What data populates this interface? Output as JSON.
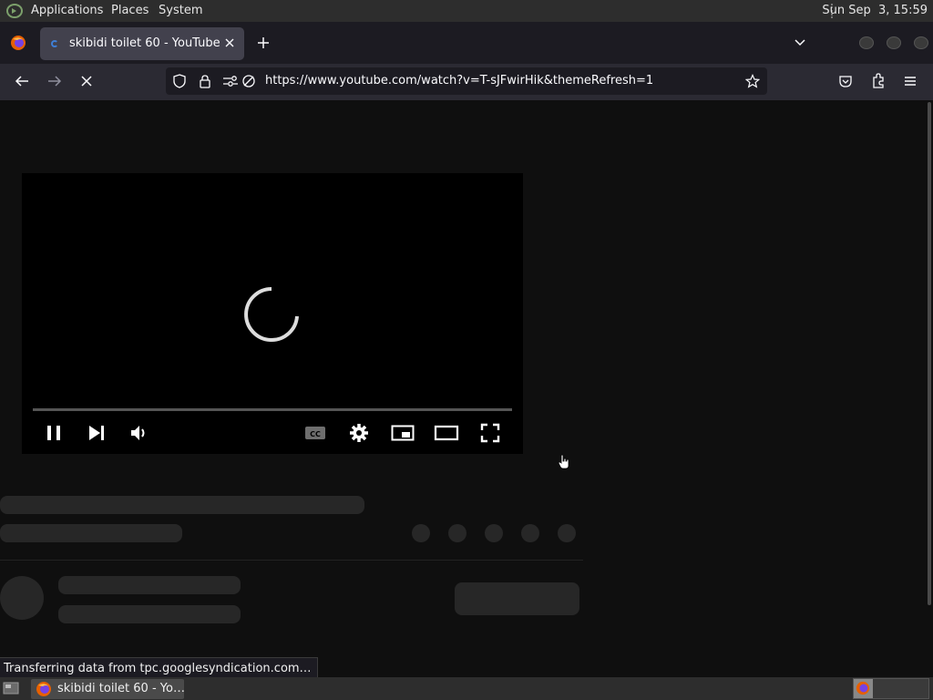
{
  "top_panel": {
    "menus": [
      "Applications",
      "Places",
      "System"
    ],
    "clock": "Sun Sep  3, 15:59"
  },
  "browser": {
    "tab_title": "skibidi toilet 60 - YouTube",
    "url": "https://www.youtube.com/watch?v=T-sJFwirHik&themeRefresh=1"
  },
  "status_tip": "Transferring data from tpc.googlesyndication.com…",
  "taskbar": {
    "item_label": "skibidi toilet 60 - Yo…"
  },
  "icons": {
    "player": [
      "pause-icon",
      "next-icon",
      "volume-icon",
      "captions-icon",
      "settings-gear-icon",
      "miniplayer-icon",
      "theater-icon",
      "fullscreen-icon",
      "loading-spinner-icon"
    ],
    "browser": [
      "back-icon",
      "forward-icon",
      "stop-icon",
      "shield-icon",
      "lock-icon",
      "permissions-icon",
      "tracking-blocked-icon",
      "bookmark-star-icon",
      "pocket-icon",
      "extensions-icon",
      "hamburger-menu-icon",
      "new-tab-icon",
      "list-all-tabs-icon",
      "firefox-icon"
    ]
  },
  "colors": {
    "page_background": "#0f0f0f",
    "browser_chrome": "#2b2a33",
    "skeleton": "#272727"
  }
}
